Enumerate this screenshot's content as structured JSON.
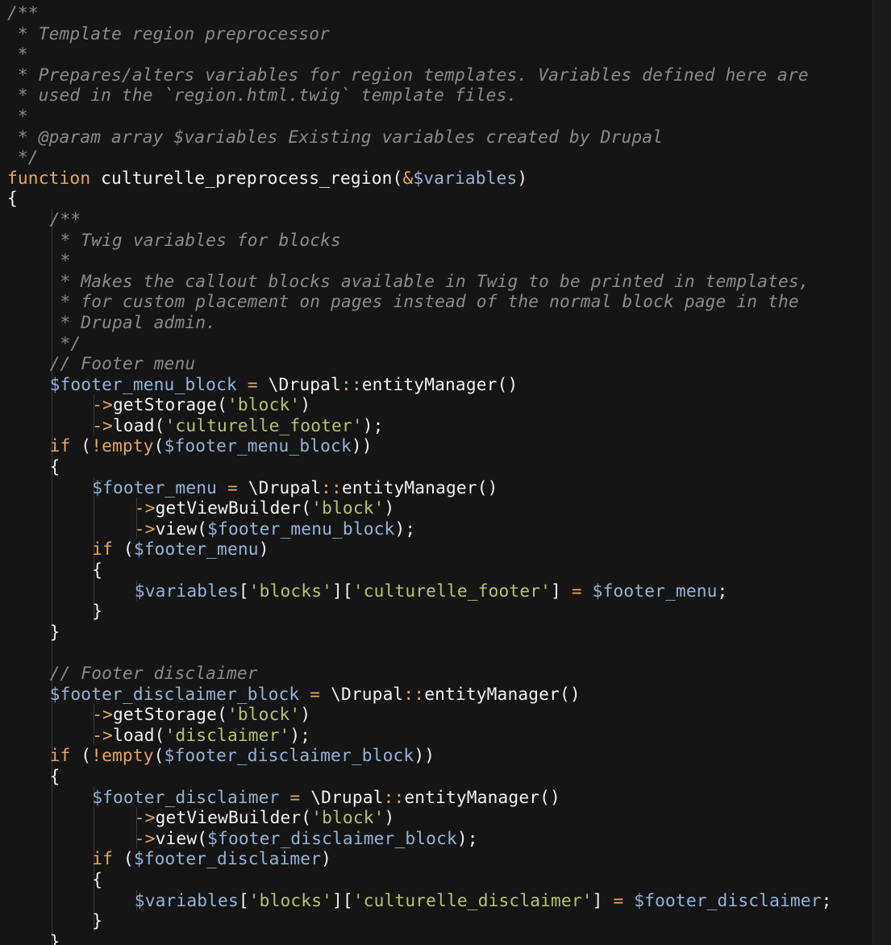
{
  "editor": {
    "language": "php",
    "colors": {
      "background": "#151515",
      "comment": "#8a8a8a",
      "keyword": "#e5a65c",
      "variable": "#93b3d8",
      "string": "#b3c46c",
      "plain": "#f0f0f0"
    },
    "lines": [
      {
        "indent": 0,
        "tokens": [
          {
            "type": "comment",
            "text": "/**"
          }
        ]
      },
      {
        "indent": 0,
        "tokens": [
          {
            "type": "comment",
            "text": " * Template region preprocessor"
          }
        ]
      },
      {
        "indent": 0,
        "tokens": [
          {
            "type": "comment",
            "text": " *"
          }
        ]
      },
      {
        "indent": 0,
        "tokens": [
          {
            "type": "comment",
            "text": " * Prepares/alters variables for region templates. Variables defined here are"
          }
        ]
      },
      {
        "indent": 0,
        "tokens": [
          {
            "type": "comment",
            "text": " * used in the `region.html.twig` template files."
          }
        ]
      },
      {
        "indent": 0,
        "tokens": [
          {
            "type": "comment",
            "text": " *"
          }
        ]
      },
      {
        "indent": 0,
        "tokens": [
          {
            "type": "comment",
            "text": " * @param array $variables Existing variables created by Drupal"
          }
        ]
      },
      {
        "indent": 0,
        "tokens": [
          {
            "type": "comment",
            "text": " */"
          }
        ]
      },
      {
        "indent": 0,
        "tokens": [
          {
            "type": "keyword",
            "text": "function"
          },
          {
            "type": "ws",
            "text": " "
          },
          {
            "type": "func",
            "text": "culturelle_preprocess_region"
          },
          {
            "type": "plain",
            "text": "("
          },
          {
            "type": "op",
            "text": "&"
          },
          {
            "type": "var",
            "text": "$variables"
          },
          {
            "type": "plain",
            "text": ")"
          }
        ]
      },
      {
        "indent": 0,
        "tokens": [
          {
            "type": "plain",
            "text": "{"
          }
        ]
      },
      {
        "indent": 1,
        "tokens": [
          {
            "type": "comment",
            "text": "/**"
          }
        ]
      },
      {
        "indent": 1,
        "tokens": [
          {
            "type": "comment",
            "text": " * Twig variables for blocks"
          }
        ]
      },
      {
        "indent": 1,
        "tokens": [
          {
            "type": "comment",
            "text": " *"
          }
        ]
      },
      {
        "indent": 1,
        "tokens": [
          {
            "type": "comment",
            "text": " * Makes the callout blocks available in Twig to be printed in templates,"
          }
        ]
      },
      {
        "indent": 1,
        "tokens": [
          {
            "type": "comment",
            "text": " * for custom placement on pages instead of the normal block page in the"
          }
        ]
      },
      {
        "indent": 1,
        "tokens": [
          {
            "type": "comment",
            "text": " * Drupal admin."
          }
        ]
      },
      {
        "indent": 1,
        "tokens": [
          {
            "type": "comment",
            "text": " */"
          }
        ]
      },
      {
        "indent": 1,
        "tokens": [
          {
            "type": "comment",
            "text": "// Footer menu"
          }
        ]
      },
      {
        "indent": 1,
        "tokens": [
          {
            "type": "var",
            "text": "$footer_menu_block"
          },
          {
            "type": "op",
            "text": " = "
          },
          {
            "type": "ns",
            "text": "\\Drupal"
          },
          {
            "type": "op",
            "text": "::"
          },
          {
            "type": "func",
            "text": "entityManager"
          },
          {
            "type": "plain",
            "text": "()"
          }
        ]
      },
      {
        "indent": 2,
        "tokens": [
          {
            "type": "op",
            "text": "->"
          },
          {
            "type": "func",
            "text": "getStorage"
          },
          {
            "type": "plain",
            "text": "("
          },
          {
            "type": "string",
            "text": "'block'"
          },
          {
            "type": "plain",
            "text": ")"
          }
        ]
      },
      {
        "indent": 2,
        "tokens": [
          {
            "type": "op",
            "text": "->"
          },
          {
            "type": "func",
            "text": "load"
          },
          {
            "type": "plain",
            "text": "("
          },
          {
            "type": "string",
            "text": "'culturelle_footer'"
          },
          {
            "type": "plain",
            "text": ");"
          }
        ]
      },
      {
        "indent": 1,
        "tokens": [
          {
            "type": "keyword",
            "text": "if"
          },
          {
            "type": "plain",
            "text": " ("
          },
          {
            "type": "bang",
            "text": "!"
          },
          {
            "type": "keyword",
            "text": "empty"
          },
          {
            "type": "plain",
            "text": "("
          },
          {
            "type": "var",
            "text": "$footer_menu_block"
          },
          {
            "type": "plain",
            "text": "))"
          }
        ]
      },
      {
        "indent": 1,
        "tokens": [
          {
            "type": "plain",
            "text": "{"
          }
        ]
      },
      {
        "indent": 2,
        "tokens": [
          {
            "type": "var",
            "text": "$footer_menu"
          },
          {
            "type": "op",
            "text": " = "
          },
          {
            "type": "ns",
            "text": "\\Drupal"
          },
          {
            "type": "op",
            "text": "::"
          },
          {
            "type": "func",
            "text": "entityManager"
          },
          {
            "type": "plain",
            "text": "()"
          }
        ]
      },
      {
        "indent": 3,
        "tokens": [
          {
            "type": "op",
            "text": "->"
          },
          {
            "type": "func",
            "text": "getViewBuilder"
          },
          {
            "type": "plain",
            "text": "("
          },
          {
            "type": "string",
            "text": "'block'"
          },
          {
            "type": "plain",
            "text": ")"
          }
        ]
      },
      {
        "indent": 3,
        "tokens": [
          {
            "type": "op",
            "text": "->"
          },
          {
            "type": "func",
            "text": "view"
          },
          {
            "type": "plain",
            "text": "("
          },
          {
            "type": "var",
            "text": "$footer_menu_block"
          },
          {
            "type": "plain",
            "text": ");"
          }
        ]
      },
      {
        "indent": 2,
        "tokens": [
          {
            "type": "keyword",
            "text": "if"
          },
          {
            "type": "plain",
            "text": " ("
          },
          {
            "type": "var",
            "text": "$footer_menu"
          },
          {
            "type": "plain",
            "text": ")"
          }
        ]
      },
      {
        "indent": 2,
        "tokens": [
          {
            "type": "plain",
            "text": "{"
          }
        ]
      },
      {
        "indent": 3,
        "tokens": [
          {
            "type": "var",
            "text": "$variables"
          },
          {
            "type": "plain",
            "text": "["
          },
          {
            "type": "string",
            "text": "'blocks'"
          },
          {
            "type": "plain",
            "text": "]["
          },
          {
            "type": "string",
            "text": "'culturelle_footer'"
          },
          {
            "type": "plain",
            "text": "]"
          },
          {
            "type": "op",
            "text": " = "
          },
          {
            "type": "var",
            "text": "$footer_menu"
          },
          {
            "type": "plain",
            "text": ";"
          }
        ]
      },
      {
        "indent": 2,
        "tokens": [
          {
            "type": "plain",
            "text": "}"
          }
        ]
      },
      {
        "indent": 1,
        "tokens": [
          {
            "type": "plain",
            "text": "}"
          }
        ]
      },
      {
        "indent": 1,
        "tokens": []
      },
      {
        "indent": 1,
        "tokens": [
          {
            "type": "comment",
            "text": "// Footer disclaimer"
          }
        ]
      },
      {
        "indent": 1,
        "tokens": [
          {
            "type": "var",
            "text": "$footer_disclaimer_block"
          },
          {
            "type": "op",
            "text": " = "
          },
          {
            "type": "ns",
            "text": "\\Drupal"
          },
          {
            "type": "op",
            "text": "::"
          },
          {
            "type": "func",
            "text": "entityManager"
          },
          {
            "type": "plain",
            "text": "()"
          }
        ]
      },
      {
        "indent": 2,
        "tokens": [
          {
            "type": "op",
            "text": "->"
          },
          {
            "type": "func",
            "text": "getStorage"
          },
          {
            "type": "plain",
            "text": "("
          },
          {
            "type": "string",
            "text": "'block'"
          },
          {
            "type": "plain",
            "text": ")"
          }
        ]
      },
      {
        "indent": 2,
        "tokens": [
          {
            "type": "op",
            "text": "->"
          },
          {
            "type": "func",
            "text": "load"
          },
          {
            "type": "plain",
            "text": "("
          },
          {
            "type": "string",
            "text": "'disclaimer'"
          },
          {
            "type": "plain",
            "text": ");"
          }
        ]
      },
      {
        "indent": 1,
        "tokens": [
          {
            "type": "keyword",
            "text": "if"
          },
          {
            "type": "plain",
            "text": " ("
          },
          {
            "type": "bang",
            "text": "!"
          },
          {
            "type": "keyword",
            "text": "empty"
          },
          {
            "type": "plain",
            "text": "("
          },
          {
            "type": "var",
            "text": "$footer_disclaimer_block"
          },
          {
            "type": "plain",
            "text": "))"
          }
        ]
      },
      {
        "indent": 1,
        "tokens": [
          {
            "type": "plain",
            "text": "{"
          }
        ]
      },
      {
        "indent": 2,
        "tokens": [
          {
            "type": "var",
            "text": "$footer_disclaimer"
          },
          {
            "type": "op",
            "text": " = "
          },
          {
            "type": "ns",
            "text": "\\Drupal"
          },
          {
            "type": "op",
            "text": "::"
          },
          {
            "type": "func",
            "text": "entityManager"
          },
          {
            "type": "plain",
            "text": "()"
          }
        ]
      },
      {
        "indent": 3,
        "tokens": [
          {
            "type": "op",
            "text": "->"
          },
          {
            "type": "func",
            "text": "getViewBuilder"
          },
          {
            "type": "plain",
            "text": "("
          },
          {
            "type": "string",
            "text": "'block'"
          },
          {
            "type": "plain",
            "text": ")"
          }
        ]
      },
      {
        "indent": 3,
        "tokens": [
          {
            "type": "op",
            "text": "->"
          },
          {
            "type": "func",
            "text": "view"
          },
          {
            "type": "plain",
            "text": "("
          },
          {
            "type": "var",
            "text": "$footer_disclaimer_block"
          },
          {
            "type": "plain",
            "text": ");"
          }
        ]
      },
      {
        "indent": 2,
        "tokens": [
          {
            "type": "keyword",
            "text": "if"
          },
          {
            "type": "plain",
            "text": " ("
          },
          {
            "type": "var",
            "text": "$footer_disclaimer"
          },
          {
            "type": "plain",
            "text": ")"
          }
        ]
      },
      {
        "indent": 2,
        "tokens": [
          {
            "type": "plain",
            "text": "{"
          }
        ]
      },
      {
        "indent": 3,
        "tokens": [
          {
            "type": "var",
            "text": "$variables"
          },
          {
            "type": "plain",
            "text": "["
          },
          {
            "type": "string",
            "text": "'blocks'"
          },
          {
            "type": "plain",
            "text": "]["
          },
          {
            "type": "string",
            "text": "'culturelle_disclaimer'"
          },
          {
            "type": "plain",
            "text": "]"
          },
          {
            "type": "op",
            "text": " = "
          },
          {
            "type": "var",
            "text": "$footer_disclaimer"
          },
          {
            "type": "plain",
            "text": ";"
          }
        ]
      },
      {
        "indent": 2,
        "tokens": [
          {
            "type": "plain",
            "text": "}"
          }
        ]
      },
      {
        "indent": 1,
        "tokens": [
          {
            "type": "plain",
            "text": "}"
          }
        ]
      }
    ]
  }
}
